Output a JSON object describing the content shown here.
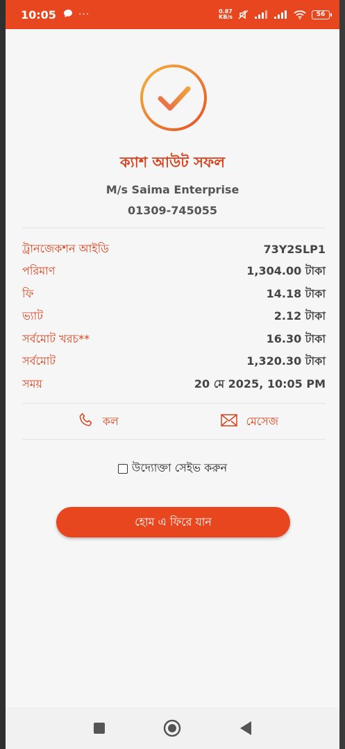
{
  "status_bar": {
    "time": "10:05",
    "chat_icon": "chat-bubble-icon",
    "more": "···",
    "speed_value": "0.87",
    "speed_unit": "KB/s",
    "battery": "56"
  },
  "result": {
    "icon": "check-circle-icon",
    "title": "ক্যাশ আউট সফল",
    "merchant_name": "M/s Saima Enterprise",
    "merchant_number": "01309-745055"
  },
  "details": [
    {
      "label": "ট্রানজেকশন আইডি",
      "value": "73Y2SLP1"
    },
    {
      "label": "পরিমাণ",
      "value": "1,304.00 টাকা"
    },
    {
      "label": "ফি",
      "value": "14.18 টাকা"
    },
    {
      "label": "ভ্যাট",
      "value": "2.12 টাকা"
    },
    {
      "label": "সর্বমোট খরচ**",
      "value": "16.30 টাকা"
    },
    {
      "label": "সর্বমোট",
      "value": "1,320.30 টাকা"
    },
    {
      "label": "সময়",
      "value": "20 মে 2025, 10:05 PM"
    }
  ],
  "actions": {
    "call_label": "কল",
    "message_label": "মেসেজ"
  },
  "save_merchant": {
    "label": "উদ্যোক্তা সেইভ করুন",
    "checked": false
  },
  "home_button": "হোম এ ফিরে যান",
  "colors": {
    "accent": "#e8461f",
    "label_red": "#d9421c",
    "check_orange": "#f0a33a"
  }
}
